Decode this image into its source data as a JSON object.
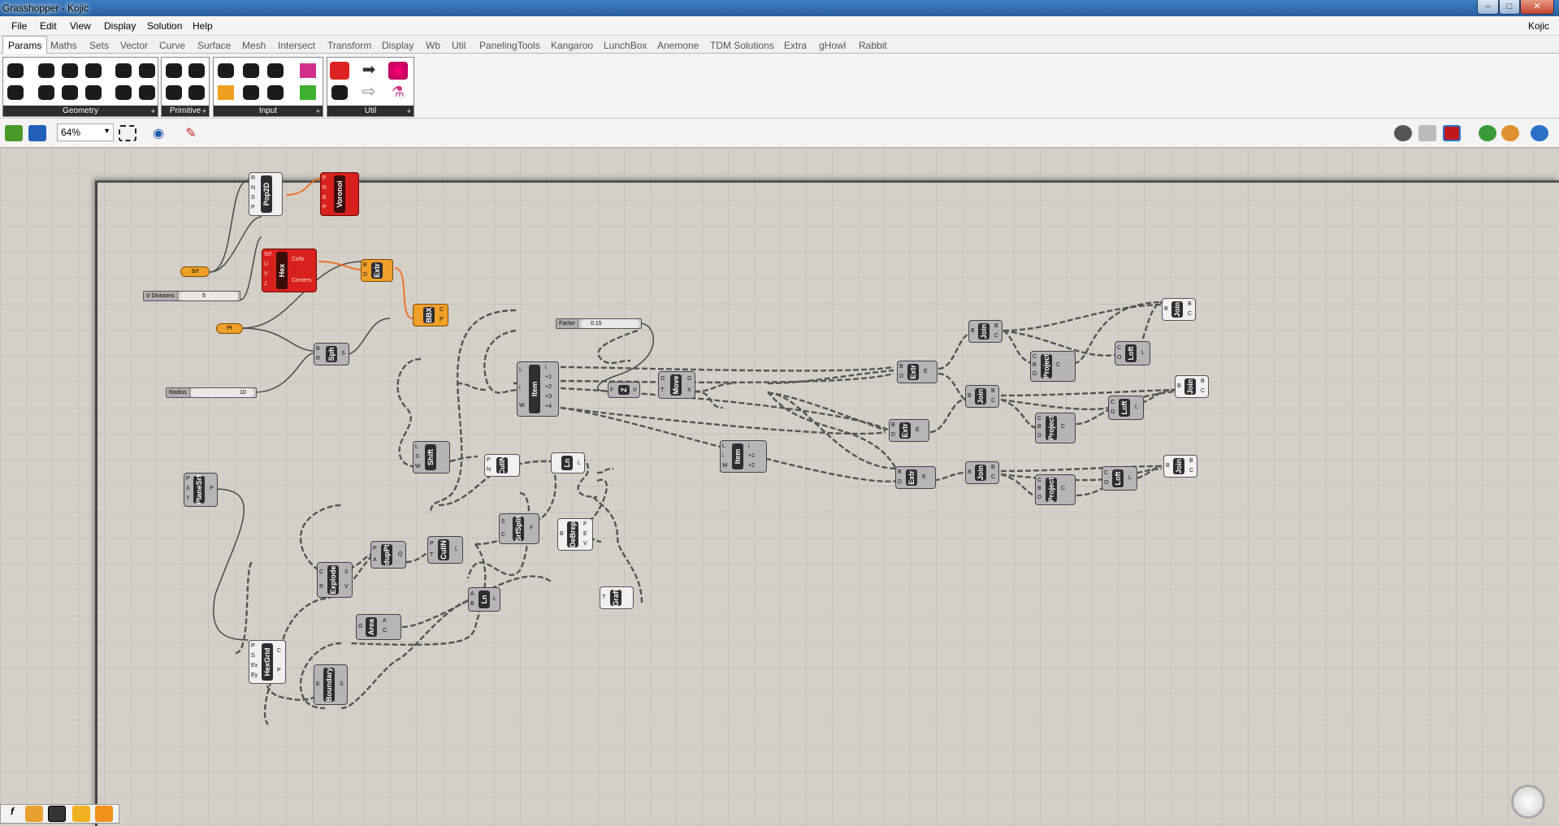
{
  "window": {
    "title": "Grasshopper - Kojic",
    "user": "Kojic"
  },
  "menu": [
    "File",
    "Edit",
    "View",
    "Display",
    "Solution",
    "Help"
  ],
  "tabs": [
    "Params",
    "Maths",
    "Sets",
    "Vector",
    "Curve",
    "Surface",
    "Mesh",
    "Intersect",
    "Transform",
    "Display",
    "Wb",
    "Util",
    "PanelingTools",
    "Kangaroo",
    "LunchBox",
    "Anemone",
    "TDM Solutions",
    "Extra",
    "gHowl",
    "Rabbit"
  ],
  "ribbon_groups": [
    "Geometry",
    "Primitive",
    "Input",
    "Util"
  ],
  "toolbar": {
    "zoom": "64%"
  },
  "nodes": [
    {
      "label": "Pop2D",
      "style": "white",
      "inputs": [
        "R",
        "N",
        "S",
        "P"
      ],
      "outputs": []
    },
    {
      "label": "Voronoi",
      "style": "red",
      "inputs": [
        "P",
        "R",
        "B",
        "P"
      ],
      "outputs": []
    },
    {
      "label": "Hex",
      "style": "red",
      "inputs": [
        "Srf",
        "U",
        "V",
        "J"
      ],
      "outputs": [
        "Cells",
        "Centers"
      ]
    },
    {
      "label": "Extr",
      "style": "orange",
      "inputs": [
        "B",
        "D"
      ],
      "outputs": []
    },
    {
      "label": "BBX",
      "style": "orange",
      "inputs": [],
      "outputs": [
        "C",
        "P"
      ]
    },
    {
      "label": "Sph",
      "style": "grey",
      "inputs": [
        "B",
        "R"
      ],
      "outputs": [
        "S"
      ]
    },
    {
      "label": "Item",
      "style": "grey",
      "inputs": [
        "L",
        "i",
        "W"
      ],
      "outputs": [
        "i",
        "+1",
        "+2",
        "+3",
        "+4"
      ]
    },
    {
      "label": "Z",
      "style": "grey",
      "inputs": [
        "F"
      ],
      "outputs": [
        "V"
      ]
    },
    {
      "label": "Move",
      "style": "grey",
      "inputs": [
        "G",
        "T"
      ],
      "outputs": [
        "G",
        "X"
      ]
    },
    {
      "label": "Shift",
      "style": "grey",
      "inputs": [
        "L",
        "S",
        "W"
      ],
      "outputs": []
    },
    {
      "label": "CullN",
      "style": "grey",
      "inputs": [
        "P",
        "N"
      ],
      "outputs": []
    },
    {
      "label": "Ln",
      "style": "grey",
      "inputs": [],
      "outputs": [
        "L"
      ]
    },
    {
      "label": "Item",
      "style": "grey",
      "inputs": [
        "L",
        "i",
        "W"
      ],
      "outputs": [
        "i",
        "+1",
        "+2"
      ]
    },
    {
      "label": "Extr",
      "style": "grey",
      "inputs": [
        "B",
        "D"
      ],
      "outputs": [
        "E"
      ]
    },
    {
      "label": "Join",
      "style": "grey",
      "inputs": [
        "B"
      ],
      "outputs": [
        "B",
        "C"
      ]
    },
    {
      "label": "Project",
      "style": "grey",
      "inputs": [
        "C",
        "B",
        "D"
      ],
      "outputs": [
        "C"
      ]
    },
    {
      "label": "Loft",
      "style": "grey",
      "inputs": [
        "C",
        "O"
      ],
      "outputs": [
        "L"
      ]
    },
    {
      "label": "Join",
      "style": "white",
      "inputs": [
        "B"
      ],
      "outputs": [
        "B",
        "C"
      ]
    },
    {
      "label": "Extr",
      "style": "grey",
      "inputs": [
        "B",
        "D"
      ],
      "outputs": [
        "E"
      ]
    },
    {
      "label": "Join",
      "style": "grey",
      "inputs": [
        "B"
      ],
      "outputs": [
        "B",
        "C"
      ]
    },
    {
      "label": "Project",
      "style": "grey",
      "inputs": [
        "C",
        "B",
        "D"
      ],
      "outputs": [
        "C"
      ]
    },
    {
      "label": "Loft",
      "style": "grey",
      "inputs": [
        "C",
        "O"
      ],
      "outputs": [
        "L"
      ]
    },
    {
      "label": "Join",
      "style": "white",
      "inputs": [
        "B"
      ],
      "outputs": [
        "B",
        "C"
      ]
    },
    {
      "label": "Extr",
      "style": "grey",
      "inputs": [
        "B",
        "D"
      ],
      "outputs": [
        "E"
      ]
    },
    {
      "label": "Join",
      "style": "grey",
      "inputs": [
        "B"
      ],
      "outputs": [
        "B",
        "C"
      ]
    },
    {
      "label": "Project",
      "style": "grey",
      "inputs": [
        "C",
        "B",
        "D"
      ],
      "outputs": [
        "C"
      ]
    },
    {
      "label": "Loft",
      "style": "grey",
      "inputs": [
        "C",
        "O"
      ],
      "outputs": [
        "L"
      ]
    },
    {
      "label": "Join",
      "style": "white",
      "inputs": [
        "B"
      ],
      "outputs": [
        "B",
        "C"
      ]
    },
    {
      "label": "PlaneSrf",
      "style": "grey",
      "inputs": [
        "P",
        "X",
        "Y"
      ],
      "outputs": [
        "P"
      ]
    },
    {
      "label": "SrfSplit",
      "style": "grey",
      "inputs": [
        "S",
        "C"
      ],
      "outputs": [
        "F"
      ]
    },
    {
      "label": "DeBrep",
      "style": "white",
      "inputs": [
        "B"
      ],
      "outputs": [
        "F",
        "E",
        "V"
      ]
    },
    {
      "label": "Graft",
      "style": "white",
      "inputs": [
        "T"
      ],
      "outputs": []
    },
    {
      "label": "dupPt",
      "style": "grey",
      "inputs": [
        "P",
        "A"
      ],
      "outputs": [
        "Q"
      ]
    },
    {
      "label": "CullN",
      "style": "grey",
      "inputs": [
        "P",
        "T"
      ],
      "outputs": [
        "L"
      ]
    },
    {
      "label": "Explode",
      "style": "grey",
      "inputs": [
        "C",
        "R"
      ],
      "outputs": [
        "S",
        "V"
      ]
    },
    {
      "label": "Ln",
      "style": "grey",
      "inputs": [
        "A",
        "B"
      ],
      "outputs": [
        "L"
      ]
    },
    {
      "label": "Area",
      "style": "grey",
      "inputs": [
        "G"
      ],
      "outputs": [
        "A",
        "C"
      ]
    },
    {
      "label": "HexGrid",
      "style": "white",
      "inputs": [
        "P",
        "S",
        "Ex",
        "Ey"
      ],
      "outputs": [
        "C",
        "P"
      ]
    },
    {
      "label": "Boundary",
      "style": "grey",
      "inputs": [
        "E"
      ],
      "outputs": [
        "S"
      ]
    }
  ],
  "params": [
    {
      "label": "Srf"
    },
    {
      "label": "Pt"
    }
  ],
  "sliders": [
    {
      "name": "V Divisions",
      "value": "5"
    },
    {
      "name": "Factor",
      "value": "0.15"
    },
    {
      "name": "Radius",
      "value": "10"
    }
  ]
}
